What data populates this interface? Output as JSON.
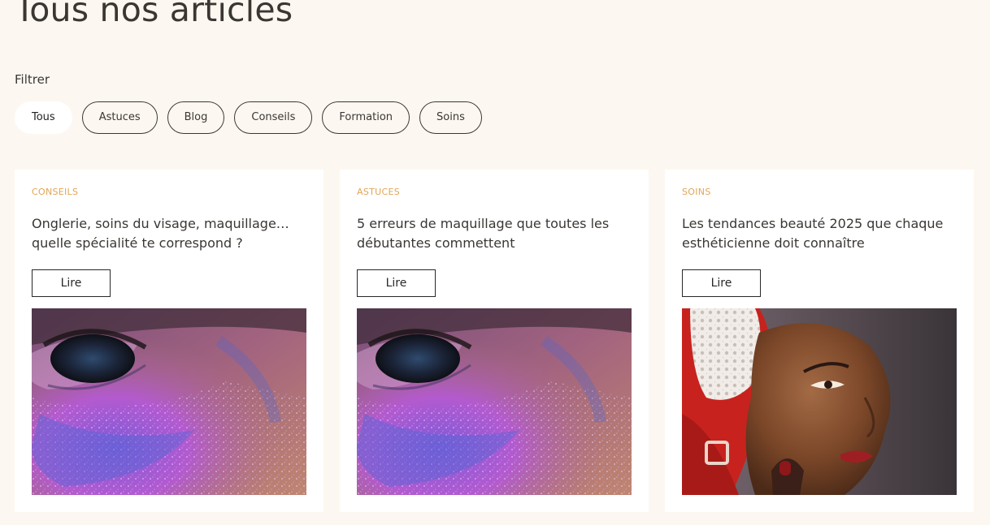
{
  "page": {
    "title": "Tous nos articles"
  },
  "filter": {
    "label": "Filtrer",
    "chips": [
      {
        "label": "Tous",
        "active": true
      },
      {
        "label": "Astuces",
        "active": false
      },
      {
        "label": "Blog",
        "active": false
      },
      {
        "label": "Conseils",
        "active": false
      },
      {
        "label": "Formation",
        "active": false
      },
      {
        "label": "Soins",
        "active": false
      }
    ]
  },
  "articles": [
    {
      "category": "CONSEILS",
      "title": "Onglerie, soins du visage, maquillage… quelle spécialité te correspond ?",
      "button_label": "Lire",
      "image_subject": "glitter-eye-makeup-photo"
    },
    {
      "category": "ASTUCES",
      "title": "5 erreurs de maquillage que toutes les débutantes commettent",
      "button_label": "Lire",
      "image_subject": "glitter-eye-makeup-photo"
    },
    {
      "category": "SOINS",
      "title": "Les tendances beauté 2025 que chaque esthéticienne doit connaître",
      "button_label": "Lire",
      "image_subject": "woman-portrait-headwrap-photo"
    }
  ],
  "colors": {
    "background": "#fdf7f1",
    "card": "#ffffff",
    "accent_category": "#e0a558",
    "text": "#3a3733"
  }
}
